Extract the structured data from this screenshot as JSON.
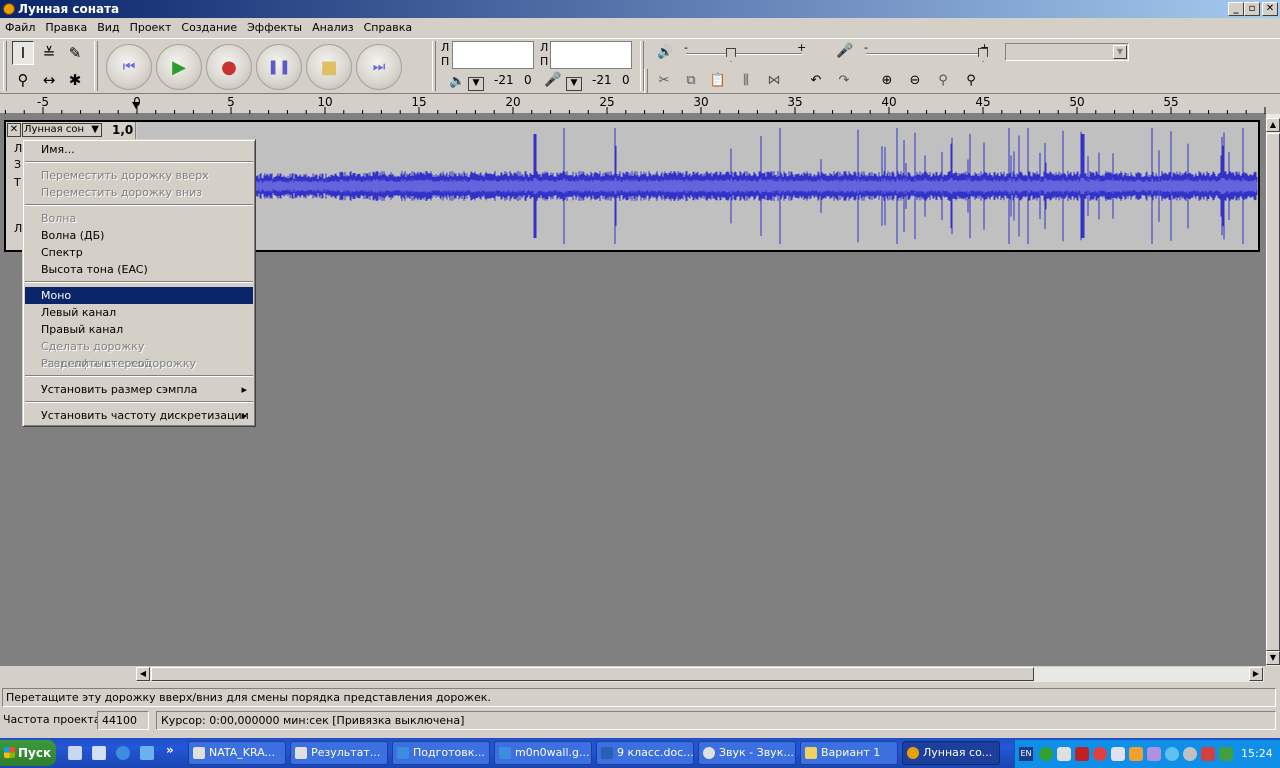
{
  "window": {
    "title": "Лунная соната",
    "minimize": "_",
    "restore": "▫",
    "close": "✕"
  },
  "menu": [
    "Файл",
    "Правка",
    "Вид",
    "Проект",
    "Создание",
    "Эффекты",
    "Анализ",
    "Справка"
  ],
  "meters": {
    "left_label": "Л",
    "right_label": "П",
    "play_db": "-21",
    "play_zero": "0",
    "rec_db": "-21",
    "rec_zero": "0"
  },
  "mixer": {
    "minus": "-",
    "plus": "+"
  },
  "ruler": {
    "labels": [
      "-5",
      "0",
      "5",
      "10",
      "15",
      "20",
      "25",
      "30",
      "35",
      "40",
      "45",
      "50",
      "55"
    ]
  },
  "track": {
    "name": "Лунная сон",
    "gain": "1,0",
    "side_letters": [
      "Л",
      "З",
      "Т",
      "Л"
    ]
  },
  "context_menu": {
    "items": [
      {
        "label": "Имя...",
        "disabled": false
      },
      {
        "sep": true
      },
      {
        "label": "Переместить дорожку вверх",
        "disabled": true
      },
      {
        "label": "Переместить дорожку вниз",
        "disabled": true
      },
      {
        "sep": true
      },
      {
        "label": "Волна",
        "disabled": true
      },
      {
        "label": "Волна (ДБ)",
        "disabled": false
      },
      {
        "label": "Спектр",
        "disabled": false
      },
      {
        "label": "Высота тона (EAC)",
        "disabled": false
      },
      {
        "sep": true
      },
      {
        "label": "Моно",
        "disabled": false,
        "highlighted": true
      },
      {
        "label": "Левый канал",
        "disabled": false
      },
      {
        "label": "Правый канал",
        "disabled": false
      },
      {
        "label": "Сделать дорожку стереофонической",
        "disabled": true
      },
      {
        "label": "Разделить стереодорожку",
        "disabled": true
      },
      {
        "sep": true
      },
      {
        "label": "Установить размер сэмпла",
        "disabled": false,
        "submenu": true
      },
      {
        "sep": true
      },
      {
        "label": "Установить частоту дискретизации",
        "disabled": false,
        "submenu": true
      }
    ]
  },
  "status": {
    "hint": "Перетащите эту дорожку вверх/вниз для смены порядка представления дорожек.",
    "rate_label": "Частота проекта:",
    "rate_value": "44100",
    "cursor": "Курсор: 0:00,000000 мин:сек   [Привязка выключена]"
  },
  "taskbar": {
    "start": "Пуск",
    "tasks": [
      "NATA_KRA...",
      "Результат...",
      "Подготовк...",
      "m0n0wall.g...",
      "9 класс.doc...",
      "Звук - Звук...",
      "Вариант 1",
      "Лунная со..."
    ],
    "lang": "EN",
    "clock": "15:24"
  },
  "colors": {
    "wave": "#3232c8",
    "wave_inner": "#6464dc",
    "highlight": "#0a246a"
  }
}
